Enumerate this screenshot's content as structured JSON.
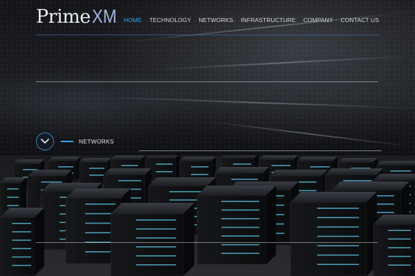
{
  "brand": {
    "prime": "Prime",
    "xm": "XM"
  },
  "nav": {
    "items": [
      {
        "label": "HOME",
        "active": true
      },
      {
        "label": "TECHNOLOGY",
        "active": false
      },
      {
        "label": "NETWORKS",
        "active": false
      },
      {
        "label": "INFRASTRUCTURE",
        "active": false
      },
      {
        "label": "COMPANY",
        "active": false
      },
      {
        "label": "CONTACT US",
        "active": false
      }
    ]
  },
  "section": {
    "label": "NETWORKS"
  },
  "icons": {
    "scroll": "chevron-down-icon"
  },
  "colors": {
    "accent": "#3aa7e8",
    "logo_accent": "#9fb6dc",
    "ring": "#3b7fb6",
    "server_light": "#5fd0f0"
  }
}
